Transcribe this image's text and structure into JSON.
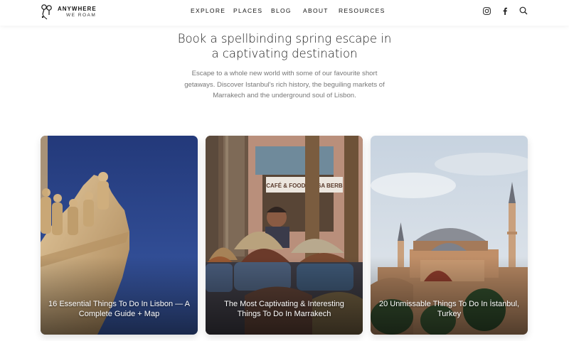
{
  "logo": {
    "line1": "ANYWHERE",
    "line2": "WE ROAM"
  },
  "nav": {
    "items": [
      {
        "label": "EXPLORE"
      },
      {
        "label": "PLACES"
      },
      {
        "label": "BLOG"
      },
      {
        "label": "ABOUT"
      },
      {
        "label": "RESOURCES"
      }
    ]
  },
  "header_icons": [
    "instagram-icon",
    "facebook-icon",
    "search-icon"
  ],
  "hero": {
    "headline_line1": "Book a spellbinding spring escape in",
    "headline_line2": "a captivating destination",
    "intro": "Escape to a whole new world with some of our favourite short getaways. Discover Istanbul's rich history, the beguiling markets of Marrakech and the underground soul of Lisbon."
  },
  "cards": [
    {
      "title": "16 Essential Things To Do In Lisbon — A Complete Guide + Map"
    },
    {
      "title": "The Most Captivating & Interesting Things To Do In Marrakech"
    },
    {
      "title": "20 Unmissable Things To Do In İstanbul, Turkey"
    }
  ],
  "card2_sign": "CAFÉ & FOOD ... ASA BERB",
  "colors": {
    "text": "#1a1a1a",
    "muted": "#777777",
    "lisbon_sky": "#2f4a8a",
    "sand": "#c9a97a"
  }
}
